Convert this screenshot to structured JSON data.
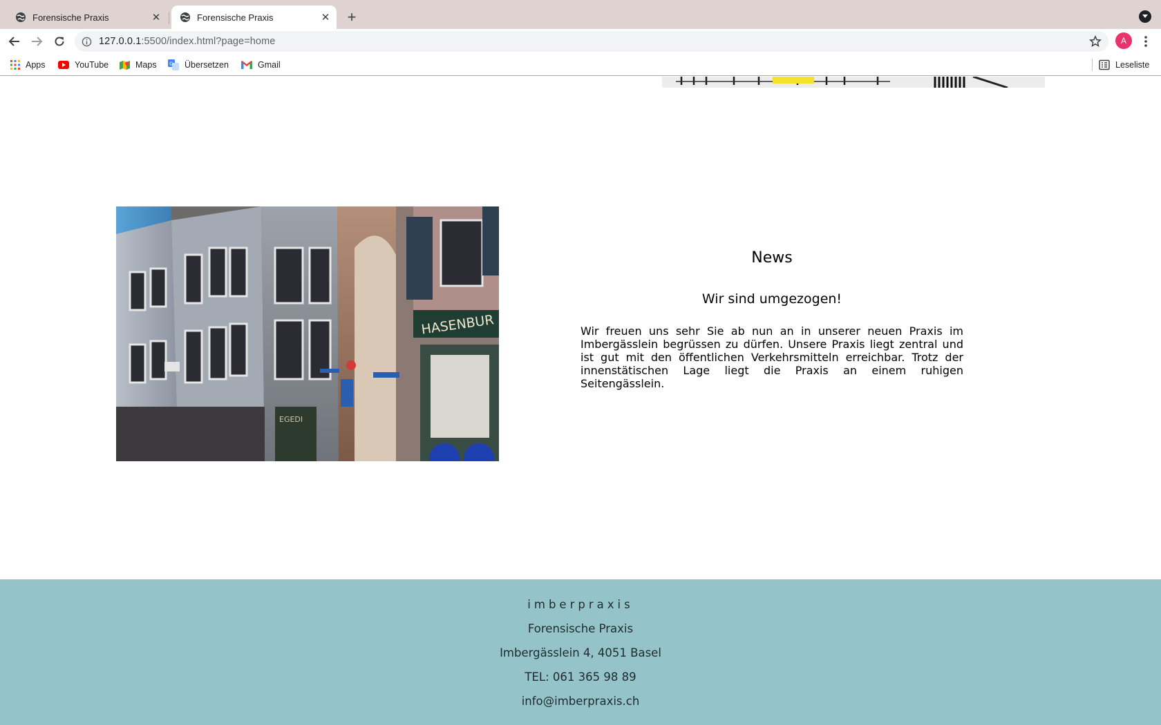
{
  "browser": {
    "tabs": [
      {
        "title": "Forensische Praxis",
        "active": false
      },
      {
        "title": "Forensische Praxis",
        "active": true
      }
    ],
    "url_host": "127.0.0.1",
    "url_path": ":5500/index.html?page=home",
    "avatar_initial": "A",
    "bookmarks": [
      {
        "label": "Apps",
        "icon": "apps-grid-icon"
      },
      {
        "label": "YouTube",
        "icon": "youtube-icon"
      },
      {
        "label": "Maps",
        "icon": "maps-icon"
      },
      {
        "label": "Übersetzen",
        "icon": "translate-icon"
      },
      {
        "label": "Gmail",
        "icon": "gmail-icon"
      }
    ],
    "reading_list": "Leseliste"
  },
  "news": {
    "heading": "News",
    "subheading": "Wir sind umgezogen!",
    "body": "Wir freuen uns sehr Sie ab nun an in unserer neuen Praxis im Imbergässlein begrüssen zu dürfen. Unsere Praxis liegt zentral und ist gut mit den öffentlichen Verkehrsmitteln erreichbar. Trotz der innenstätischen Lage liegt die Praxis an einem ruhigen Seitengässlein."
  },
  "footer": {
    "brand": "imberpraxis",
    "name": "Forensische Praxis",
    "address": "Imbergässlein 4, 4051 Basel",
    "phone": "TEL: 061 365 98 89",
    "email": "info@imberpraxis.ch"
  },
  "colors": {
    "tabstrip": "#dfd3d1",
    "footer_bg": "#94c3c9",
    "avatar": "#e8336d"
  }
}
